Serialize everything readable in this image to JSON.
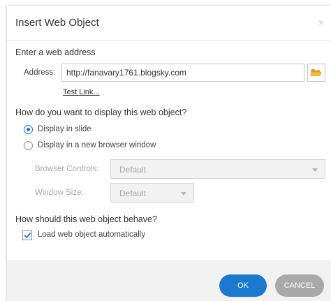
{
  "dialog": {
    "title": "Insert Web Object",
    "close_label": "×"
  },
  "web_address": {
    "heading": "Enter a web address",
    "address_label": "Address:",
    "address_value": "http://fanavary1761.blogsky.com",
    "test_link_label": "Test Link...",
    "browse_icon": "folder-open-icon"
  },
  "display": {
    "heading": "How do you want to display this web object?",
    "options": [
      "Display in slide",
      "Display in a new browser window"
    ],
    "selected": "Display in slide",
    "browser_controls_label": "Browser Controls:",
    "browser_controls_value": "Default",
    "window_size_label": "Window Size:",
    "window_size_value": "Default"
  },
  "behavior": {
    "heading": "How should this web object behave?",
    "load_auto_label": "Load web object automatically",
    "load_auto_checked": true
  },
  "footer": {
    "ok_label": "OK",
    "cancel_label": "CANCEL"
  },
  "colors": {
    "accent": "#1b79cf",
    "cancel": "#a9a9a9",
    "folder": "#e5a823"
  }
}
